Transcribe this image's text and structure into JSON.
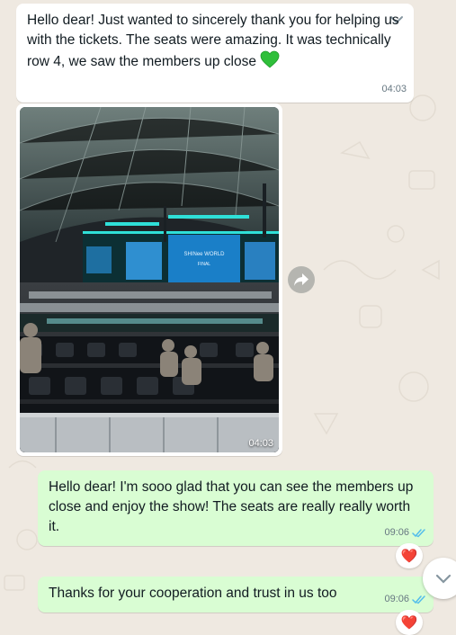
{
  "messages": [
    {
      "text": "Hello dear! Just wanted to sincerely thank you for helping us with the tickets. The seats were amazing. It was technically row 4, we saw the members up close",
      "emoji": "green-heart",
      "time": "04:03"
    },
    {
      "image": "concert-arena-photo",
      "time": "04:03"
    },
    {
      "text": "Hello dear! I'm sooo glad that you can see the members up close and enjoy the show! The seats are really really worth it.",
      "time": "09:06",
      "reaction": "❤️"
    },
    {
      "text": "Thanks for your cooperation and trust in us too",
      "time": "09:06",
      "reaction": "❤️"
    }
  ],
  "colors": {
    "incoming_bubble": "#ffffff",
    "outgoing_bubble": "#d9fdd3",
    "read_ticks": "#53bdeb",
    "background": "#efe9e1"
  },
  "icons": [
    "chevron-down-icon",
    "forward-icon",
    "double-check-icon",
    "scroll-down-icon"
  ]
}
